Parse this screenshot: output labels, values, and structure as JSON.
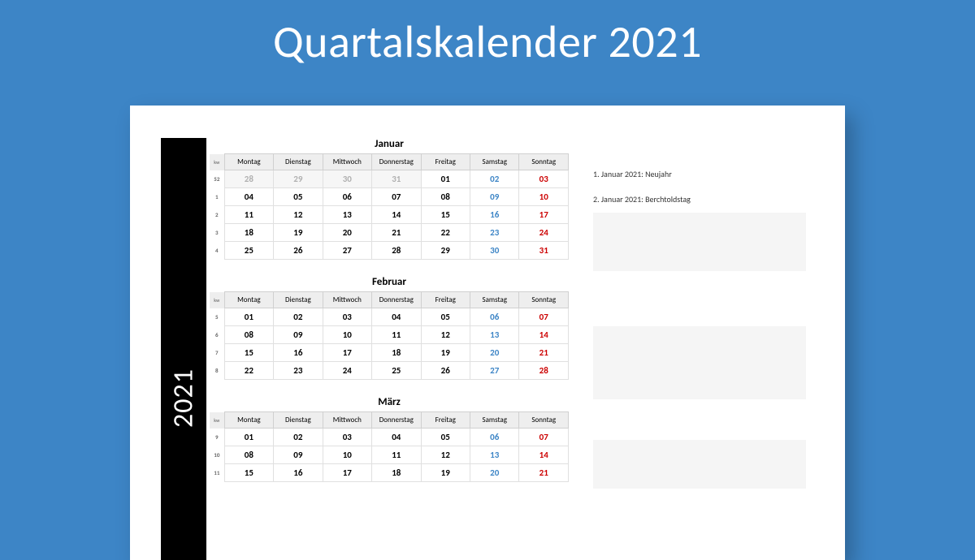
{
  "title": "Quartalskalender 2021",
  "year": "2021",
  "kw_label": "kw",
  "weekdays": [
    "Montag",
    "Dienstag",
    "Mittwoch",
    "Donnerstag",
    "Freitag",
    "Samstag",
    "Sonntag"
  ],
  "months": [
    {
      "name": "Januar",
      "rows": [
        {
          "kw": "52",
          "days": [
            {
              "d": "28",
              "cls": "faded"
            },
            {
              "d": "29",
              "cls": "faded"
            },
            {
              "d": "30",
              "cls": "faded"
            },
            {
              "d": "31",
              "cls": "faded"
            },
            {
              "d": "01",
              "cls": ""
            },
            {
              "d": "02",
              "cls": "sat"
            },
            {
              "d": "03",
              "cls": "sun"
            }
          ]
        },
        {
          "kw": "1",
          "days": [
            {
              "d": "04",
              "cls": ""
            },
            {
              "d": "05",
              "cls": ""
            },
            {
              "d": "06",
              "cls": ""
            },
            {
              "d": "07",
              "cls": ""
            },
            {
              "d": "08",
              "cls": ""
            },
            {
              "d": "09",
              "cls": "sat"
            },
            {
              "d": "10",
              "cls": "sun"
            }
          ]
        },
        {
          "kw": "2",
          "days": [
            {
              "d": "11",
              "cls": ""
            },
            {
              "d": "12",
              "cls": ""
            },
            {
              "d": "13",
              "cls": ""
            },
            {
              "d": "14",
              "cls": ""
            },
            {
              "d": "15",
              "cls": ""
            },
            {
              "d": "16",
              "cls": "sat"
            },
            {
              "d": "17",
              "cls": "sun"
            }
          ]
        },
        {
          "kw": "3",
          "days": [
            {
              "d": "18",
              "cls": ""
            },
            {
              "d": "19",
              "cls": ""
            },
            {
              "d": "20",
              "cls": ""
            },
            {
              "d": "21",
              "cls": ""
            },
            {
              "d": "22",
              "cls": ""
            },
            {
              "d": "23",
              "cls": "sat"
            },
            {
              "d": "24",
              "cls": "sun"
            }
          ]
        },
        {
          "kw": "4",
          "days": [
            {
              "d": "25",
              "cls": ""
            },
            {
              "d": "26",
              "cls": ""
            },
            {
              "d": "27",
              "cls": ""
            },
            {
              "d": "28",
              "cls": ""
            },
            {
              "d": "29",
              "cls": ""
            },
            {
              "d": "30",
              "cls": "sat"
            },
            {
              "d": "31",
              "cls": "sun"
            }
          ]
        }
      ]
    },
    {
      "name": "Februar",
      "rows": [
        {
          "kw": "5",
          "days": [
            {
              "d": "01",
              "cls": ""
            },
            {
              "d": "02",
              "cls": ""
            },
            {
              "d": "03",
              "cls": ""
            },
            {
              "d": "04",
              "cls": ""
            },
            {
              "d": "05",
              "cls": ""
            },
            {
              "d": "06",
              "cls": "sat"
            },
            {
              "d": "07",
              "cls": "sun"
            }
          ]
        },
        {
          "kw": "6",
          "days": [
            {
              "d": "08",
              "cls": ""
            },
            {
              "d": "09",
              "cls": ""
            },
            {
              "d": "10",
              "cls": ""
            },
            {
              "d": "11",
              "cls": ""
            },
            {
              "d": "12",
              "cls": ""
            },
            {
              "d": "13",
              "cls": "sat"
            },
            {
              "d": "14",
              "cls": "sun"
            }
          ]
        },
        {
          "kw": "7",
          "days": [
            {
              "d": "15",
              "cls": ""
            },
            {
              "d": "16",
              "cls": ""
            },
            {
              "d": "17",
              "cls": ""
            },
            {
              "d": "18",
              "cls": ""
            },
            {
              "d": "19",
              "cls": ""
            },
            {
              "d": "20",
              "cls": "sat"
            },
            {
              "d": "21",
              "cls": "sun"
            }
          ]
        },
        {
          "kw": "8",
          "days": [
            {
              "d": "22",
              "cls": ""
            },
            {
              "d": "23",
              "cls": ""
            },
            {
              "d": "24",
              "cls": ""
            },
            {
              "d": "25",
              "cls": ""
            },
            {
              "d": "26",
              "cls": ""
            },
            {
              "d": "27",
              "cls": "sat"
            },
            {
              "d": "28",
              "cls": "sun"
            }
          ]
        }
      ]
    },
    {
      "name": "März",
      "rows": [
        {
          "kw": "9",
          "days": [
            {
              "d": "01",
              "cls": ""
            },
            {
              "d": "02",
              "cls": ""
            },
            {
              "d": "03",
              "cls": ""
            },
            {
              "d": "04",
              "cls": ""
            },
            {
              "d": "05",
              "cls": ""
            },
            {
              "d": "06",
              "cls": "sat"
            },
            {
              "d": "07",
              "cls": "sun"
            }
          ]
        },
        {
          "kw": "10",
          "days": [
            {
              "d": "08",
              "cls": ""
            },
            {
              "d": "09",
              "cls": ""
            },
            {
              "d": "10",
              "cls": ""
            },
            {
              "d": "11",
              "cls": ""
            },
            {
              "d": "12",
              "cls": ""
            },
            {
              "d": "13",
              "cls": "sat"
            },
            {
              "d": "14",
              "cls": "sun"
            }
          ]
        },
        {
          "kw": "11",
          "days": [
            {
              "d": "15",
              "cls": ""
            },
            {
              "d": "16",
              "cls": ""
            },
            {
              "d": "17",
              "cls": ""
            },
            {
              "d": "18",
              "cls": ""
            },
            {
              "d": "19",
              "cls": ""
            },
            {
              "d": "20",
              "cls": "sat"
            },
            {
              "d": "21",
              "cls": "sun"
            }
          ]
        }
      ]
    }
  ],
  "notes": [
    "1. Januar 2021: Neujahr",
    "2. Januar 2021: Berchtoldstag"
  ]
}
